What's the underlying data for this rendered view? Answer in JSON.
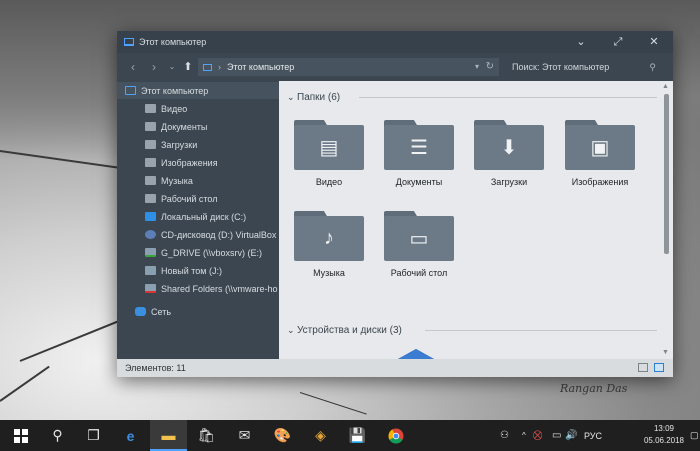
{
  "window": {
    "title": "Этот компьютер",
    "minimize": "⌄",
    "maximize": "⤢",
    "close": "✕"
  },
  "nav": {
    "back": "‹",
    "forward": "›",
    "recent": "⌄",
    "address": "Этот компьютер",
    "address_sep": "›",
    "refresh": "↻",
    "search_placeholder": "Поиск: Этот компьютер"
  },
  "sidebar": {
    "items": [
      {
        "label": "Этот компьютер",
        "icon": "computer-icon"
      },
      {
        "label": "Видео",
        "icon": "video-folder-icon"
      },
      {
        "label": "Документы",
        "icon": "documents-folder-icon"
      },
      {
        "label": "Загрузки",
        "icon": "downloads-folder-icon"
      },
      {
        "label": "Изображения",
        "icon": "pictures-folder-icon"
      },
      {
        "label": "Музыка",
        "icon": "music-folder-icon"
      },
      {
        "label": "Рабочий стол",
        "icon": "desktop-folder-icon"
      },
      {
        "label": "Локальный диск (C:)",
        "icon": "windows-drive-icon"
      },
      {
        "label": "CD-дисковод (D:) VirtualBox G",
        "icon": "cd-drive-icon"
      },
      {
        "label": "G_DRIVE (\\\\vboxsrv) (E:)",
        "icon": "network-drive-icon"
      },
      {
        "label": "Новый том (J:)",
        "icon": "drive-icon"
      },
      {
        "label": "Shared Folders (\\\\vmware-ho",
        "icon": "disconnected-drive-icon"
      },
      {
        "label": "Сеть",
        "icon": "network-icon"
      }
    ]
  },
  "content": {
    "folders_header": "Папки (6)",
    "drives_header": "Устройства и диски (3)",
    "folders": [
      {
        "label": "Видео",
        "glyph": "▤",
        "icon": "video-icon"
      },
      {
        "label": "Документы",
        "glyph": "☰",
        "icon": "document-icon"
      },
      {
        "label": "Загрузки",
        "glyph": "⬇",
        "icon": "download-icon"
      },
      {
        "label": "Изображения",
        "glyph": "▣",
        "icon": "image-icon"
      },
      {
        "label": "Музыка",
        "glyph": "♪",
        "icon": "music-icon"
      },
      {
        "label": "Рабочий стол",
        "glyph": "▭",
        "icon": "desktop-icon"
      }
    ]
  },
  "status": {
    "items_count": "Элементов: 11"
  },
  "taskbar": {
    "icons": [
      "windows-start-icon",
      "search-icon",
      "task-view-icon",
      "edge-icon",
      "file-explorer-icon",
      "store-icon",
      "mail-icon",
      "paint-icon",
      "vmware-icon",
      "save-icon",
      "chrome-icon"
    ],
    "language": "РУС",
    "time": "13:09",
    "date": "05.06.2018"
  },
  "desktop": {
    "signature": "Rangan Das"
  },
  "colors": {
    "accent": "#4da3ff",
    "window_bg": "#3b4650",
    "content_bg": "#e7e9ec",
    "folder": "#6c7a87",
    "taskbar": "#1f1f1f"
  }
}
